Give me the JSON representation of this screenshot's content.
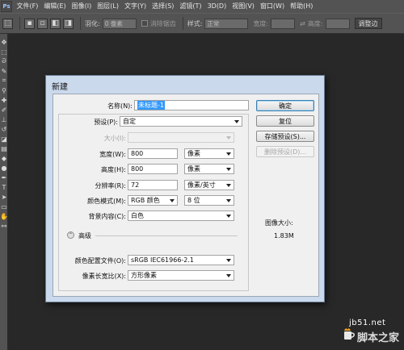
{
  "app": {
    "logo": "Ps"
  },
  "menu": [
    "文件(F)",
    "编辑(E)",
    "图像(I)",
    "图层(L)",
    "文字(Y)",
    "选择(S)",
    "滤镜(T)",
    "3D(D)",
    "视图(V)",
    "窗口(W)",
    "帮助(H)"
  ],
  "options": {
    "feather_label": "羽化:",
    "feather_value": "0 像素",
    "antialias_label": "消除锯齿",
    "style_label": "样式:",
    "style_value": "正常",
    "width_label": "宽度:",
    "height_label": "高度:",
    "refine_label": "调整边"
  },
  "dialog": {
    "title": "新建",
    "name_label": "名称(N):",
    "name_value": "未标题-1",
    "preset_label": "预设(P):",
    "preset_value": "自定",
    "size_label": "大小(I):",
    "width_label": "宽度(W):",
    "width_value": "800",
    "width_unit": "像素",
    "height_label": "高度(H):",
    "height_value": "800",
    "height_unit": "像素",
    "res_label": "分辨率(R):",
    "res_value": "72",
    "res_unit": "像素/英寸",
    "mode_label": "颜色模式(M):",
    "mode_value": "RGB 颜色",
    "mode_depth": "8 位",
    "bg_label": "背景内容(C):",
    "bg_value": "白色",
    "advanced_label": "高级",
    "profile_label": "颜色配置文件(O):",
    "profile_value": "sRGB IEC61966-2.1",
    "aspect_label": "像素长宽比(X):",
    "aspect_value": "方形像素",
    "ok_label": "确定",
    "reset_label": "复位",
    "save_preset_label": "存储预设(S)...",
    "delete_preset_label": "删除预设(D)...",
    "image_size_label": "图像大小:",
    "image_size_value": "1.83M"
  },
  "watermark": {
    "site": "jb51.net",
    "logo": "脚本之家"
  }
}
